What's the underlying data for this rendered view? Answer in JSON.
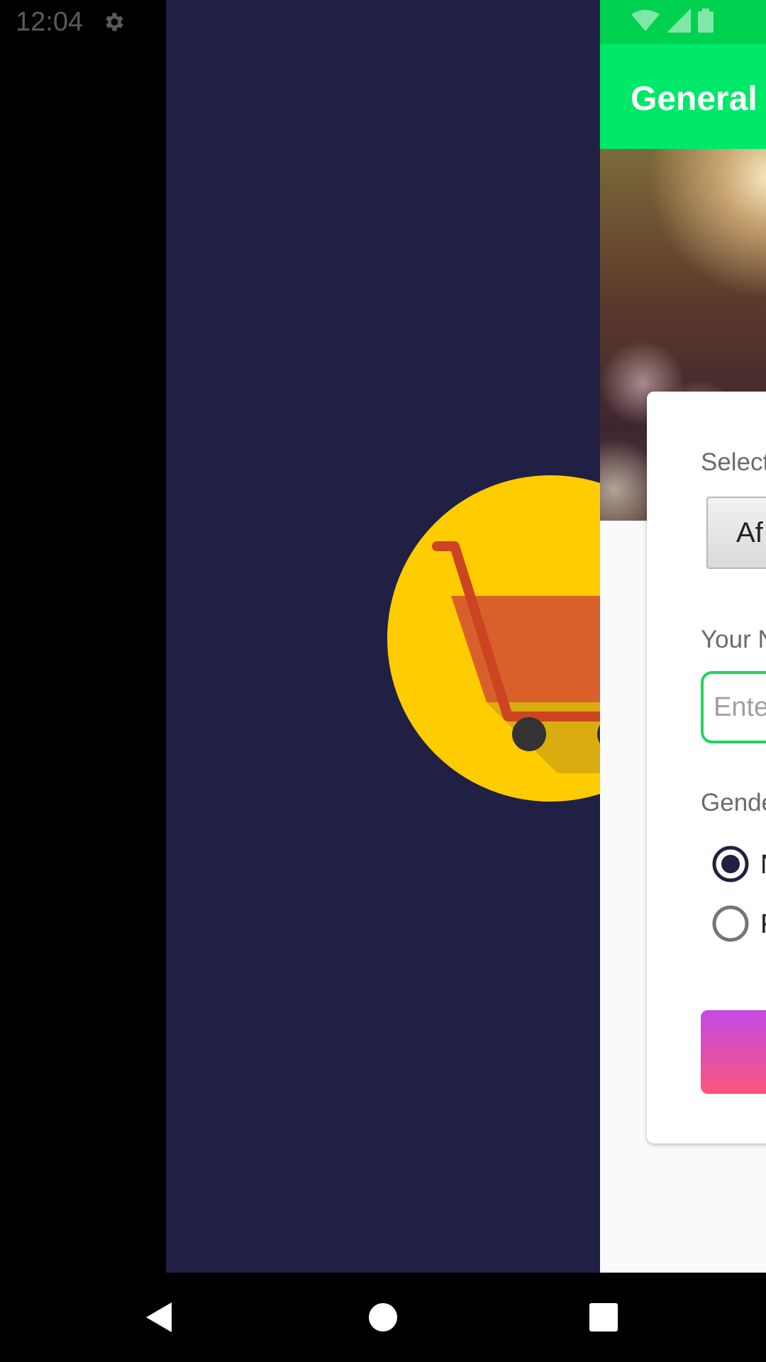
{
  "status_bar": {
    "time": "12:04"
  },
  "app": {
    "toolbar_title": "General",
    "colors": {
      "toolbar": "#00e86a",
      "status": "#00d14f",
      "accent": "#22d35a",
      "radio": "#202045"
    },
    "form": {
      "country_label": "Select",
      "country_value": "Af",
      "name_label": "Your N",
      "name_placeholder": "Ente",
      "gender_label": "Gende",
      "gender_options": [
        {
          "label": "N",
          "selected": true
        },
        {
          "label": "F",
          "selected": false
        }
      ],
      "submit_label": ""
    }
  },
  "splash": {
    "background": "#202045",
    "logo_icon": "shopping-cart-icon"
  },
  "nav_bar": {
    "icons": [
      "back-icon",
      "home-icon",
      "recents-icon"
    ]
  }
}
